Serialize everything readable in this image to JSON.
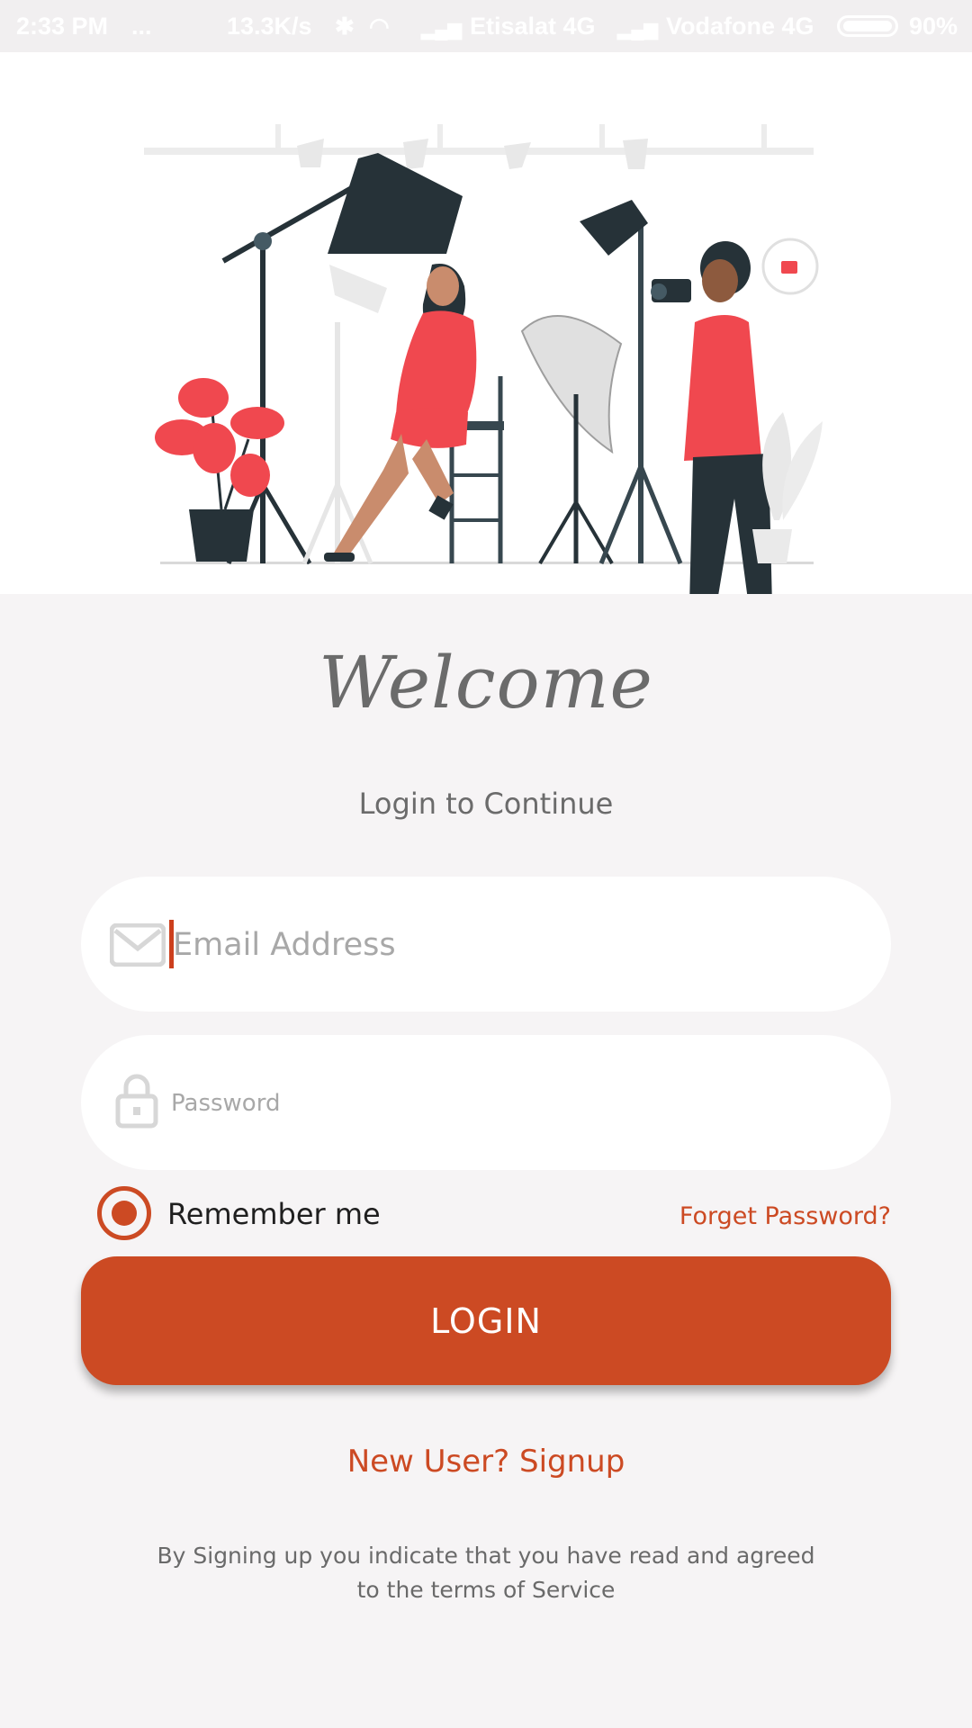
{
  "status_bar": {
    "time": "2:33 PM",
    "more": "...",
    "network_speed": "13.3K/s",
    "carrier_1": "Etisalat 4G",
    "carrier_2": "Vodafone 4G",
    "battery": "90%",
    "icons": [
      "bluetooth-icon",
      "wifi-icon",
      "signal-icon",
      "battery-icon"
    ]
  },
  "hero": {
    "illustration": "photo-studio-illustration"
  },
  "welcome": {
    "title": "Welcome",
    "subtitle": "Login to Continue"
  },
  "form": {
    "email_placeholder": "Email Address",
    "password_placeholder": "Password",
    "remember_label": "Remember me",
    "remember_checked": true,
    "forgot_label": "Forget Password?",
    "login_label": "LOGIN"
  },
  "footer": {
    "signup_label": "New User? Signup",
    "terms_text": "By Signing up you indicate that you have read and agreed to the terms of Service"
  },
  "colors": {
    "accent": "#cc4a23",
    "background": "#f6f4f5",
    "text_muted": "#6b6b6b"
  }
}
